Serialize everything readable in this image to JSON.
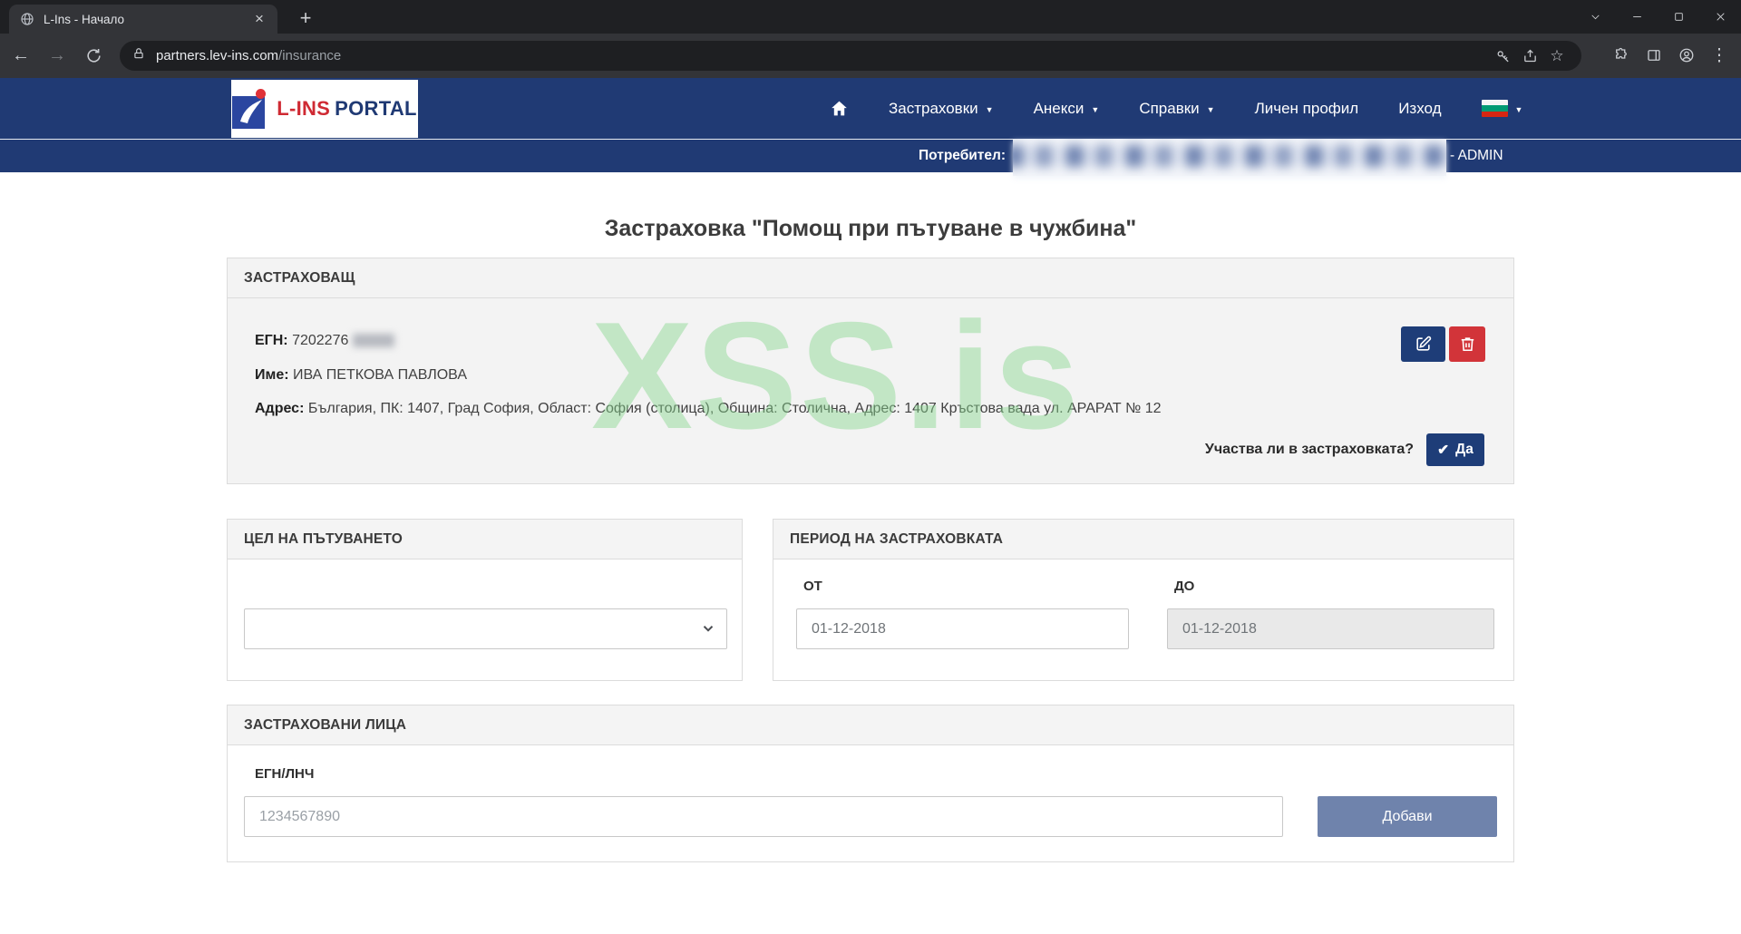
{
  "browser": {
    "tab_title": "L-Ins - Начало",
    "url_host": "partners.lev-ins.com",
    "url_path": "/insurance"
  },
  "icons": {
    "caret": "▼",
    "close_tab": "×",
    "new_tab": "+",
    "back": "←",
    "forward": "→",
    "star": "☆",
    "overflow_menu": "⋮",
    "check": "✔"
  },
  "navbar": {
    "logo_primary": "L-INS",
    "logo_secondary": "PORTAL",
    "items": [
      {
        "label": "Застраховки"
      },
      {
        "label": "Анекси"
      },
      {
        "label": "Справки"
      },
      {
        "label": "Личен профил"
      },
      {
        "label": "Изход"
      }
    ]
  },
  "userbar": {
    "label": "Потребител:",
    "role": "- ADMIN"
  },
  "page": {
    "title": "Застраховка \"Помощ при пътуване в чужбина\"",
    "watermark": "XSS.is",
    "insurer": {
      "header": "ЗАСТРАХОВАЩ",
      "egn_label": "ЕГН:",
      "egn_value": "7202276",
      "name_label": "Име:",
      "name_value": "ИВА ПЕТКОВА ПАВЛОВА",
      "address_label": "Адрес:",
      "address_value": "България, ПК: 1407, Град София, Област: София (столица), Община: Столична, Адрес: 1407 Кръстова вада ул. АРАРАТ № 12",
      "participates_label": "Участва ли в застраховката?",
      "yes_label": "Да"
    },
    "purpose": {
      "header": "ЦЕЛ НА ПЪТУВАНЕТО"
    },
    "period": {
      "header": "ПЕРИОД НА ЗАСТРАХОВКАТА",
      "from_label": "ОТ",
      "from_value": "01-12-2018",
      "to_label": "ДО",
      "to_value": "01-12-2018"
    },
    "insured": {
      "header": "ЗАСТРАХОВАНИ ЛИЦА",
      "egn_label": "ЕГН/ЛНЧ",
      "egn_placeholder": "1234567890",
      "add_label": "Добави"
    }
  },
  "colors": {
    "navy": "#203a74",
    "button_navy": "#1e3d78",
    "button_red": "#d23439",
    "button_muted_blue": "#6f83ac",
    "watermark_green": "#bfe3c3"
  }
}
